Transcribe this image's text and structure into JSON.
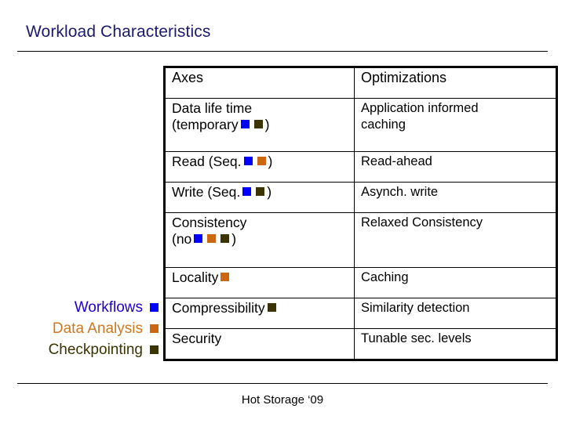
{
  "slide": {
    "title": "Workload Characteristics",
    "footer": "Hot Storage ‘09"
  },
  "colors": {
    "workflows": "#0000ff",
    "data_analysis": "#cc6611",
    "checkpointing": "#3b3300",
    "title_text": "#1a1a6e",
    "header_text": "#2200cc",
    "data_analysis_text": "#cc7722",
    "workflows_text": "#2200cc",
    "checkpointing_text": "#3b3300"
  },
  "legend": {
    "items": [
      {
        "label": "Workflows",
        "swatch": "workflows-swatch",
        "color": "#0000ff"
      },
      {
        "label": "Data Analysis",
        "swatch": "data-analysis-swatch",
        "color": "#cc6611"
      },
      {
        "label": "Checkpointing",
        "swatch": "checkpointing-swatch",
        "color": "#3b3300"
      }
    ]
  },
  "table": {
    "headers": {
      "axes": "Axes",
      "optimizations": "Optimizations"
    },
    "rows": [
      {
        "axis_line1": "Data life time",
        "axis_line2_pre": "(temporary",
        "axis_line2_post": ")",
        "markers": [
          "#0000ff",
          "#3b3300"
        ],
        "optimization_line1": "Application informed",
        "optimization_line2": "caching"
      },
      {
        "axis_line1": "",
        "axis_line2_pre": "Read (Seq.",
        "axis_line2_post": ")",
        "markers": [
          "#0000ff",
          "#cc6611"
        ],
        "optimization_line1": "Read-ahead",
        "optimization_line2": ""
      },
      {
        "axis_line1": "",
        "axis_line2_pre": "Write (Seq.",
        "axis_line2_post": ")",
        "markers": [
          "#0000ff",
          "#3b3300"
        ],
        "optimization_line1": "Asynch. write",
        "optimization_line2": ""
      },
      {
        "axis_line1": "Consistency",
        "axis_line2_pre": "(no",
        "axis_line2_post": ")",
        "markers": [
          "#0000ff",
          "#cc6611",
          "#3b3300"
        ],
        "optimization_line1": "Relaxed Consistency",
        "optimization_line2": ""
      },
      {
        "axis_line1": "",
        "axis_line2_pre": "Locality",
        "axis_line2_post": "",
        "markers": [
          "#cc6611"
        ],
        "optimization_line1": "Caching",
        "optimization_line2": ""
      },
      {
        "axis_line1": "",
        "axis_line2_pre": "Compressibility",
        "axis_line2_post": "",
        "markers": [
          "#3b3300"
        ],
        "optimization_line1": "Similarity detection",
        "optimization_line2": ""
      },
      {
        "axis_line1": "",
        "axis_line2_pre": "Security",
        "axis_line2_post": "",
        "markers": [],
        "optimization_line1": "Tunable sec. levels",
        "optimization_line2": ""
      }
    ]
  }
}
